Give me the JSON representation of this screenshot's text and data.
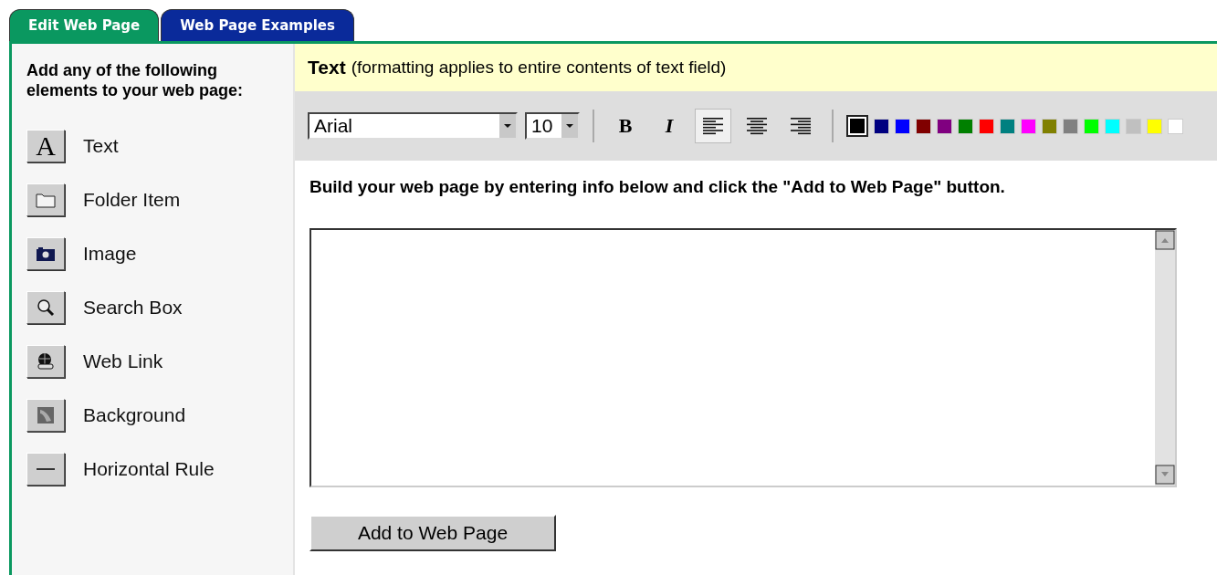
{
  "tabs": [
    {
      "label": "Edit Web Page",
      "selected": true
    },
    {
      "label": "Web Page Examples",
      "selected": false
    }
  ],
  "sidebar": {
    "heading": "Add any of the following elements to your web page:",
    "items": [
      {
        "kind": "text",
        "glyph": "A",
        "label": "Text"
      },
      {
        "kind": "folder",
        "label": "Folder Item"
      },
      {
        "kind": "image",
        "label": "Image"
      },
      {
        "kind": "search",
        "label": "Search Box"
      },
      {
        "kind": "link",
        "label": "Web Link"
      },
      {
        "kind": "background",
        "label": "Background"
      },
      {
        "kind": "rule",
        "label": "Horizontal Rule"
      }
    ]
  },
  "panel": {
    "title": "Text",
    "note": "(formatting applies to entire contents of text field)"
  },
  "toolbar": {
    "font": "Arial",
    "size": "10",
    "bold": {
      "label": "B",
      "on": false
    },
    "italic": {
      "label": "I",
      "on": false
    },
    "align": [
      {
        "kind": "left",
        "selected": true
      },
      {
        "kind": "center",
        "selected": false
      },
      {
        "kind": "right",
        "selected": false
      }
    ],
    "colors": [
      {
        "color": "#000000",
        "selected": true
      },
      {
        "color": "#000080",
        "selected": false
      },
      {
        "color": "#0000ff",
        "selected": false
      },
      {
        "color": "#800000",
        "selected": false
      },
      {
        "color": "#800080",
        "selected": false
      },
      {
        "color": "#008000",
        "selected": false
      },
      {
        "color": "#ff0000",
        "selected": false
      },
      {
        "color": "#008080",
        "selected": false
      },
      {
        "color": "#ff00ff",
        "selected": false
      },
      {
        "color": "#808000",
        "selected": false
      },
      {
        "color": "#808080",
        "selected": false
      },
      {
        "color": "#00ff00",
        "selected": false
      },
      {
        "color": "#00ffff",
        "selected": false
      },
      {
        "color": "#c0c0c0",
        "selected": false
      },
      {
        "color": "#ffff00",
        "selected": false
      },
      {
        "color": "#ffffff",
        "selected": false
      }
    ]
  },
  "instructions": "Build your web page by entering info below and click the \"Add to Web Page\" button.",
  "submit": "Add to Web Page"
}
